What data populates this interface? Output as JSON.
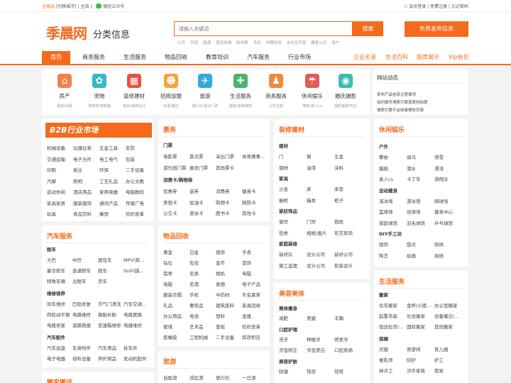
{
  "top": {
    "left": [
      "全国站",
      "[切换城市]",
      "主站"
    ],
    "wechat": "微信公众号",
    "right": [
      "会员登录",
      "免费注册",
      "忘记密码"
    ]
  },
  "logo": "季晨网",
  "slogan": "分类信息",
  "search": {
    "placeholder": "请输入关键词",
    "button": "搜索",
    "hot": [
      "公司",
      "开锁",
      "疏通",
      "管道疏通",
      "除甲醛",
      "吊车",
      "甲醛检测",
      "米东区开锁",
      "搬家公司",
      "海宁"
    ]
  },
  "publish": "免费发布信息",
  "nav": {
    "items": [
      "首页",
      "商务服务",
      "生活服务",
      "物品回收",
      "教育培训",
      "汽车服务",
      "行业市场"
    ],
    "right": [
      "企业名录",
      "生活百科",
      "图库展示",
      "Vip会员"
    ]
  },
  "cats": [
    {
      "name": "房产",
      "sub": "租房/出租",
      "color": "#f0824a",
      "icon": "⌂"
    },
    {
      "name": "宠物",
      "sub": "宠物狗/宠物猫",
      "color": "#35b8c8",
      "icon": "✿"
    },
    {
      "name": "装修建材",
      "sub": "家具/装修设计",
      "color": "#e8523b",
      "icon": "▦"
    },
    {
      "name": "招商加盟",
      "sub": "红酒/餐饮",
      "color": "#f6a33c",
      "icon": "☻"
    },
    {
      "name": "旅游",
      "sub": "旅行社/景点门票",
      "color": "#33aad8",
      "icon": "✈"
    },
    {
      "name": "生活服务",
      "sub": "搬家/家电维修",
      "color": "#4ab46a",
      "icon": "✚"
    },
    {
      "name": "商务服务",
      "sub": "公司注册",
      "color": "#f08a3c",
      "icon": "♟"
    },
    {
      "name": "休闲娱乐",
      "sub": "攀岩/真人cs",
      "color": "#e25a5a",
      "icon": "☂"
    },
    {
      "name": "婚庆摄影",
      "sub": "摄影摄像/司仪",
      "color": "#3cbcae",
      "icon": "◉"
    }
  ],
  "news": {
    "title": "网站动态",
    "items": [
      "发布产品信息注意事项",
      "如何撰写搜索引擎喜爱的标题",
      "搜索引擎不会收录哪些页面"
    ]
  },
  "b2b": {
    "banner": "B2B行业市场",
    "rows": [
      [
        "机械设备",
        "仪器仪表",
        "五金工具",
        "安防"
      ],
      [
        "交通运输",
        "电子元件",
        "电工电气",
        "包装"
      ],
      [
        "印刷",
        "纸业",
        "环保",
        "二手设备"
      ],
      [
        "汽摩",
        "照明",
        "工艺礼品",
        "办公文教"
      ],
      [
        "运动休闲",
        "酒店用品",
        "家用电器",
        "电脑数码"
      ],
      [
        "家具家居",
        "服装服饰",
        "通讯产品",
        "传媒广电"
      ],
      [
        "玩具",
        "食品饮料",
        "橡塑",
        "纺织皮革"
      ]
    ]
  },
  "car": {
    "title": "汽车服务",
    "groups": [
      {
        "sub": "租车",
        "rows": [
          [
            "大巴",
            "中巴",
            "面包车",
            "MPV(商..."
          ],
          [
            "豪华轿车",
            "普通轿车",
            "跑车",
            "SUV(越..."
          ],
          [
            "特殊车辆",
            "出租车",
            "货车"
          ]
        ]
      },
      {
        "sub": "维修保养",
        "rows": [
          [
            "刹车维修",
            "凹陷修复",
            "节气门清洗",
            "汽车空调..."
          ],
          [
            "四轮动平衡",
            "电路维修",
            "换胎补胎",
            "电瓶更换"
          ],
          [
            "电瓶修复",
            "道路救援",
            "变速箱维修",
            "电器维修"
          ]
        ]
      },
      {
        "sub": "汽车配件",
        "rows": [
          [
            "汽车底盘",
            "车身附件",
            "汽车用品",
            "拆车件"
          ],
          [
            "电子电器",
            "视听设备",
            "养护用品",
            "发动机配件"
          ]
        ]
      }
    ]
  },
  "car_next": "搬家搬运",
  "fun": {
    "title": "票务",
    "groups": [
      {
        "sub": "门票",
        "rows": [
          [
            "电影票",
            "景点票",
            "演出门票",
            "体育赛事..."
          ],
          [
            "游乐园门票",
            "展览门票",
            "其他票卡"
          ]
        ]
      },
      {
        "sub": "消费卡/购物券",
        "rows": [
          [
            "优惠券",
            "返券",
            "消费券",
            "健身卡"
          ],
          [
            "美容卡",
            "加油卡",
            "购物卡",
            "网购卡"
          ],
          [
            "公交卡",
            "游泳卡",
            "图书卡",
            "其他卡"
          ]
        ]
      }
    ]
  },
  "recycle": {
    "title": "物品回收",
    "rows": [
      [
        "黄金",
        "白金",
        "银饰",
        "手表"
      ],
      [
        "钻石",
        "包包",
        "金币",
        "首饰"
      ],
      [
        "翡翠",
        "名表",
        "相机",
        "电脑"
      ],
      [
        "电脑",
        "名酒",
        "香烟",
        "电子产品"
      ],
      [
        "服装衣帽",
        "手机",
        "中药材",
        "冬虫夏草"
      ],
      [
        "礼品",
        "奢侈品",
        "建筑废料",
        "家具回收"
      ],
      [
        "办公用品",
        "电池",
        "塑料",
        "金属"
      ],
      [
        "玻璃",
        "艺术品",
        "废纸",
        "纺织皮革"
      ],
      [
        "废橡胶",
        "工程机械",
        "二手设备",
        "库存积压"
      ]
    ]
  },
  "travel": {
    "title": "旅游",
    "rows": [
      [
        "自助游",
        "郊区游",
        "旅行社",
        "一日游"
      ]
    ]
  },
  "deco": {
    "title": "装修建材",
    "groups": [
      {
        "sub": "建材",
        "rows": [
          [
            "门",
            "窗",
            "五金"
          ],
          [
            "钢材",
            "油漆",
            "涂料"
          ]
        ]
      },
      {
        "sub": "家具",
        "rows": [
          [
            "沙发",
            "床",
            "床垫"
          ],
          [
            "橱柜",
            "箱类",
            "柜子"
          ]
        ]
      },
      {
        "sub": "家纺饰品",
        "rows": [
          [
            "窗帘",
            "门帘",
            "抱枕"
          ],
          [
            "垫类",
            "相框/画片",
            "布艺软饰"
          ]
        ]
      },
      {
        "sub": "家庭装修",
        "rows": [
          [
            "装修队",
            "设计公司",
            "装修公司"
          ],
          [
            "施工监理",
            "设计公司",
            "软装设计"
          ]
        ]
      }
    ]
  },
  "beauty": {
    "title": "美容美体",
    "groups": [
      {
        "sub": "美体瘦身",
        "rows": [
          [
            "减肥",
            "美腿",
            "丰胸"
          ]
        ]
      },
      {
        "sub": "口腔护理",
        "rows": [
          [
            "洗牙",
            "种植牙",
            "烤瓷牙"
          ],
          [
            "牙齿矫正",
            "牙齿美白",
            "口腔疾病"
          ]
        ]
      },
      {
        "sub": "美容护肤",
        "rows": [
          [
            "除皱",
            "祛痘",
            "祛斑"
          ]
        ]
      }
    ]
  },
  "leisure": {
    "title": "休闲娱乐",
    "groups": [
      {
        "sub": "户外",
        "rows": [
          [
            "攀岩",
            "骑马",
            "滑雪"
          ],
          [
            "蹦极",
            "潜水",
            "漂流"
          ],
          [
            "真人cs",
            "卡丁车",
            "滑翔伞"
          ]
        ]
      },
      {
        "sub": "运动健身",
        "rows": [
          [
            "溜冰场",
            "游泳馆",
            "网球场"
          ],
          [
            "篮球场",
            "足球场",
            "健身中心"
          ],
          [
            "保龄球馆",
            "羽毛球馆",
            "乒乓球馆"
          ]
        ]
      },
      {
        "sub": "DIY手工坊",
        "rows": [
          [
            "银饰",
            "甜点",
            "刺绣"
          ],
          [
            "陶艺",
            "绘画",
            "烘焙"
          ]
        ]
      }
    ]
  },
  "life": {
    "title": "生活服务",
    "groups": [
      {
        "sub": "搬家",
        "rows": [
          [
            "住宅搬家",
            "金杯/小面...",
            "办公室搬家"
          ],
          [
            "起重吊装",
            "长途搬家",
            "设备搬迁/..."
          ],
          [
            "短途拉货/...",
            "国际搬家",
            "其他搬家"
          ]
        ]
      },
      {
        "sub": "保姆",
        "rows": [
          [
            "月嫂",
            "育婴师",
            "育儿嫂"
          ],
          [
            "催乳师",
            "陪护",
            "护工"
          ],
          [
            "钟点工",
            "涉外家政",
            "管家"
          ]
        ]
      }
    ]
  }
}
